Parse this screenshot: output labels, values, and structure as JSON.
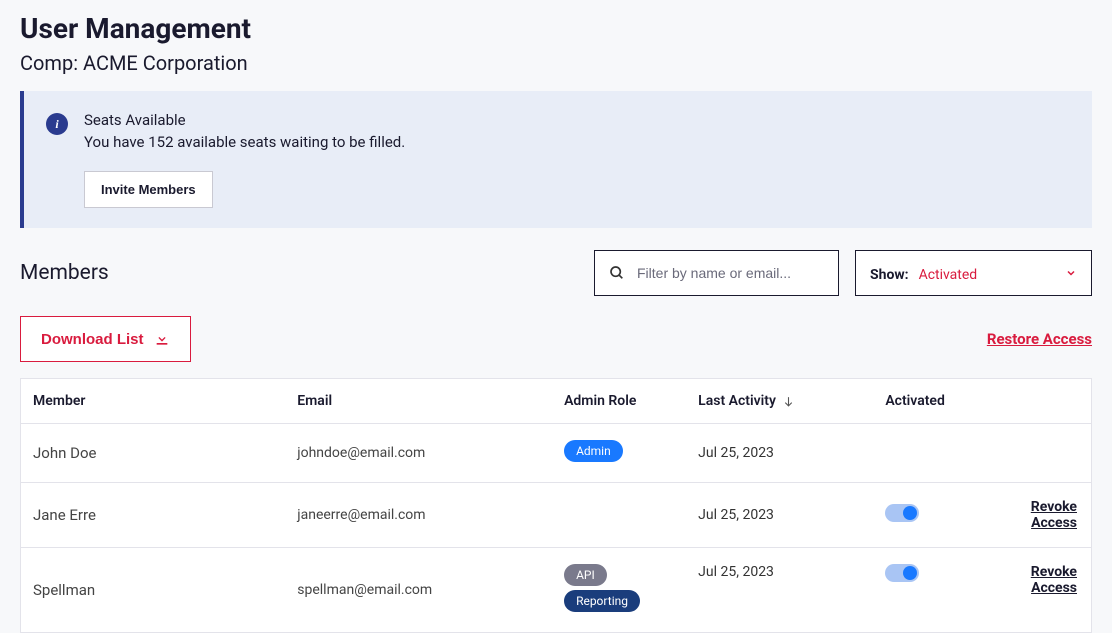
{
  "page": {
    "title": "User Management",
    "subtitle": "Comp: ACME Corporation"
  },
  "banner": {
    "title": "Seats Available",
    "text": "You have 152 available seats waiting to be filled.",
    "invite_label": "Invite Members"
  },
  "members": {
    "heading": "Members",
    "search_placeholder": "Filter by name or email...",
    "show_label": "Show:",
    "show_value": "Activated"
  },
  "actions": {
    "download_label": "Download List",
    "restore_label": "Restore Access"
  },
  "table": {
    "headers": {
      "member": "Member",
      "email": "Email",
      "admin_role": "Admin Role",
      "last_activity": "Last Activity",
      "activated": "Activated"
    },
    "revoke_label": "Revoke Access",
    "rows": [
      {
        "member": "John Doe",
        "email": "johndoe@email.com",
        "roles": [
          {
            "label": "Admin",
            "style": "admin"
          }
        ],
        "last_activity": "Jul 25, 2023",
        "toggle": false,
        "revoke": false
      },
      {
        "member": "Jane Erre",
        "email": "janeerre@email.com",
        "roles": [],
        "last_activity": "Jul 25, 2023",
        "toggle": true,
        "revoke": true
      },
      {
        "member": "Spellman",
        "email": "spellman@email.com",
        "roles": [
          {
            "label": "API",
            "style": "api"
          },
          {
            "label": "Reporting",
            "style": "reporting"
          }
        ],
        "last_activity": "Jul 25, 2023",
        "toggle": true,
        "revoke": true
      }
    ]
  }
}
